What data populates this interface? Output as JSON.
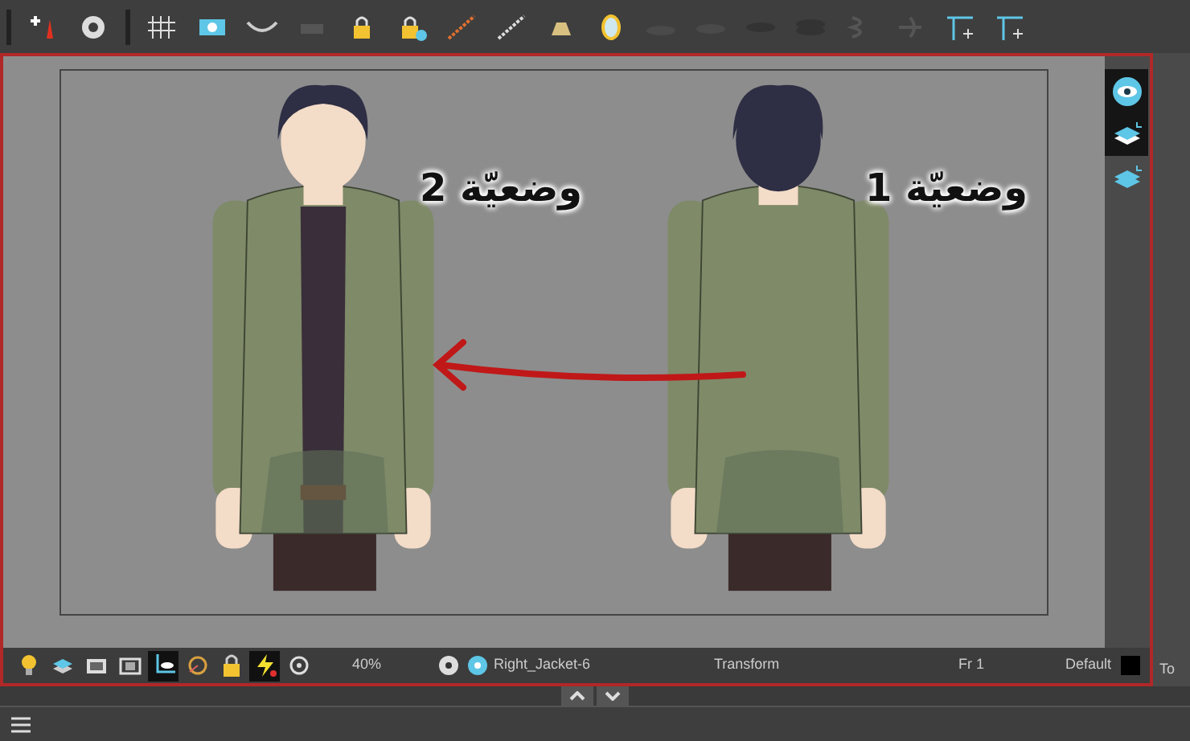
{
  "canvas": {
    "labels": [
      {
        "text": "وضعيّة 1"
      },
      {
        "text": "وضعيّة 2"
      }
    ]
  },
  "side_tools": [
    {
      "kind": "eye",
      "selected": true
    },
    {
      "kind": "layer-l",
      "selected": true
    },
    {
      "kind": "layer-c",
      "selected": false
    }
  ],
  "status_tools": [
    {
      "kind": "bulb",
      "selected": false
    },
    {
      "kind": "layers",
      "selected": false
    },
    {
      "kind": "frame",
      "selected": false
    },
    {
      "kind": "safe",
      "selected": false
    },
    {
      "kind": "crop",
      "selected": true
    },
    {
      "kind": "onion",
      "selected": false
    },
    {
      "kind": "lock",
      "selected": false
    },
    {
      "kind": "bolt",
      "selected": true
    },
    {
      "kind": "target",
      "selected": false
    }
  ],
  "status_bar": {
    "zoom": "40%",
    "drawing": "Right_Jacket-6",
    "tool": "Transform",
    "frame": "Fr 1",
    "palette": "Default"
  },
  "right_panel_label": "To"
}
